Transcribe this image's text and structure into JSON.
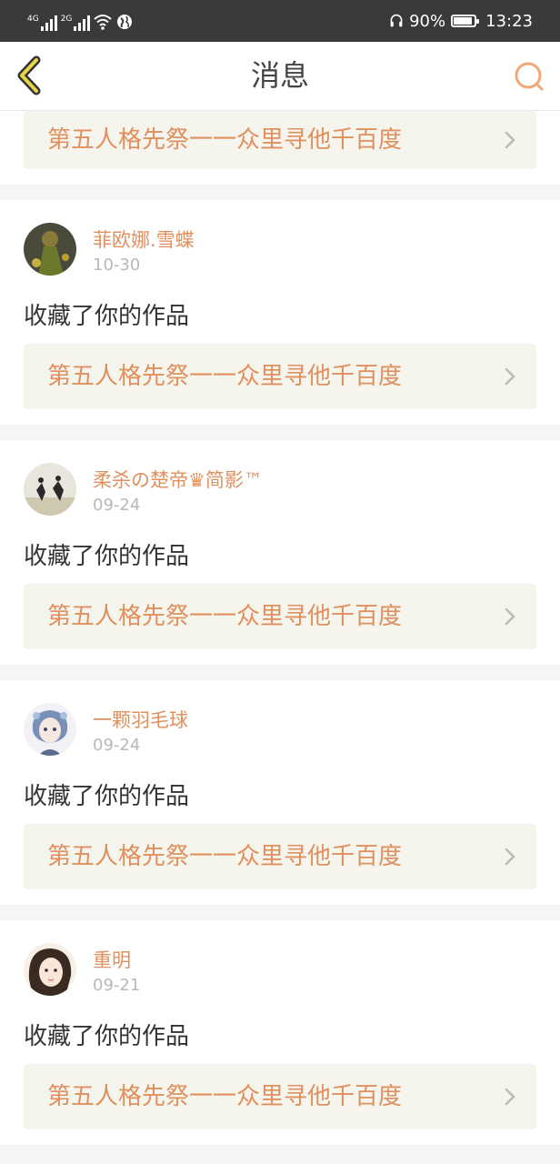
{
  "status_bar": {
    "network1": "4G",
    "network2": "2G",
    "battery_percent": "90%",
    "battery_level": 0.9,
    "time": "13:23"
  },
  "header": {
    "title": "消息",
    "back_icon": "chevron-left-icon",
    "search_icon": "search-icon",
    "accent_color": "#e0905e",
    "back_icon_color": "#e8d44a"
  },
  "top_card": {
    "work_title": "第五人格先祭一一众里寻他千百度"
  },
  "messages": [
    {
      "user": "菲欧娜.雪蝶",
      "date": "10-30",
      "action": "收藏了你的作品",
      "work_title": "第五人格先祭一一众里寻他千百度"
    },
    {
      "user": "柔杀の楚帝♛简影™",
      "date": "09-24",
      "action": "收藏了你的作品",
      "work_title": "第五人格先祭一一众里寻他千百度"
    },
    {
      "user": "一颗羽毛球",
      "date": "09-24",
      "action": "收藏了你的作品",
      "work_title": "第五人格先祭一一众里寻他千百度"
    },
    {
      "user": "重明",
      "date": "09-21",
      "action": "收藏了你的作品",
      "work_title": "第五人格先祭一一众里寻他千百度"
    }
  ]
}
